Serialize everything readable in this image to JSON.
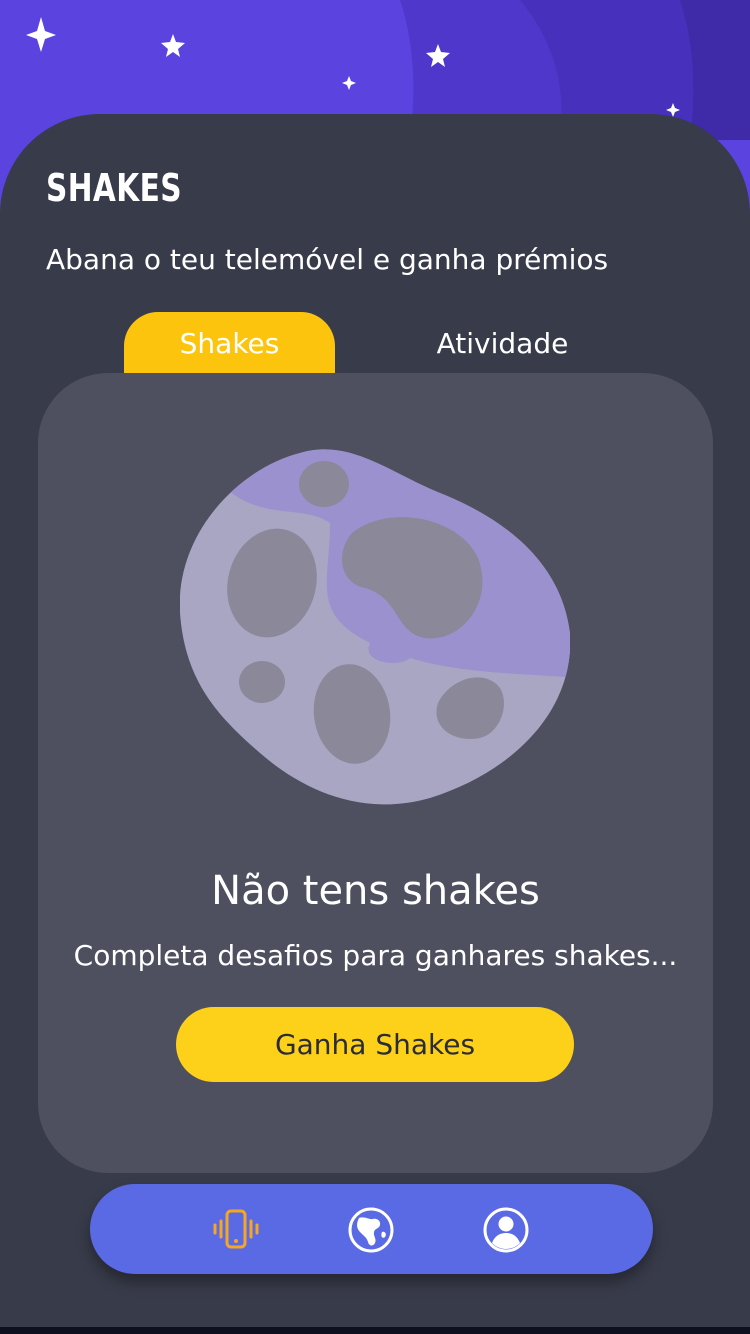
{
  "app": {
    "title": "SHAKES",
    "subtitle": "Abana o teu telemóvel e ganha prémios"
  },
  "tabs": [
    {
      "label": "Shakes",
      "active": true
    },
    {
      "label": "Atividade",
      "active": false
    }
  ],
  "empty_state": {
    "illustration": "asteroid-illustration",
    "title": "Não tens shakes",
    "description": "Completa desafios para ganhares shakes...",
    "button_label": "Ganha Shakes"
  },
  "bottom_nav": {
    "items": [
      {
        "icon": "vibrating-phone-icon",
        "active": true
      },
      {
        "icon": "globe-icon",
        "active": false
      },
      {
        "icon": "profile-icon",
        "active": false
      }
    ]
  },
  "colors": {
    "header_purple": "#5b43e0",
    "background": "#383b4a",
    "card": "#4e5060",
    "accent_yellow": "#fdc40e",
    "nav_blue": "#5a6ae4",
    "asteroid": "#9b95c8"
  }
}
